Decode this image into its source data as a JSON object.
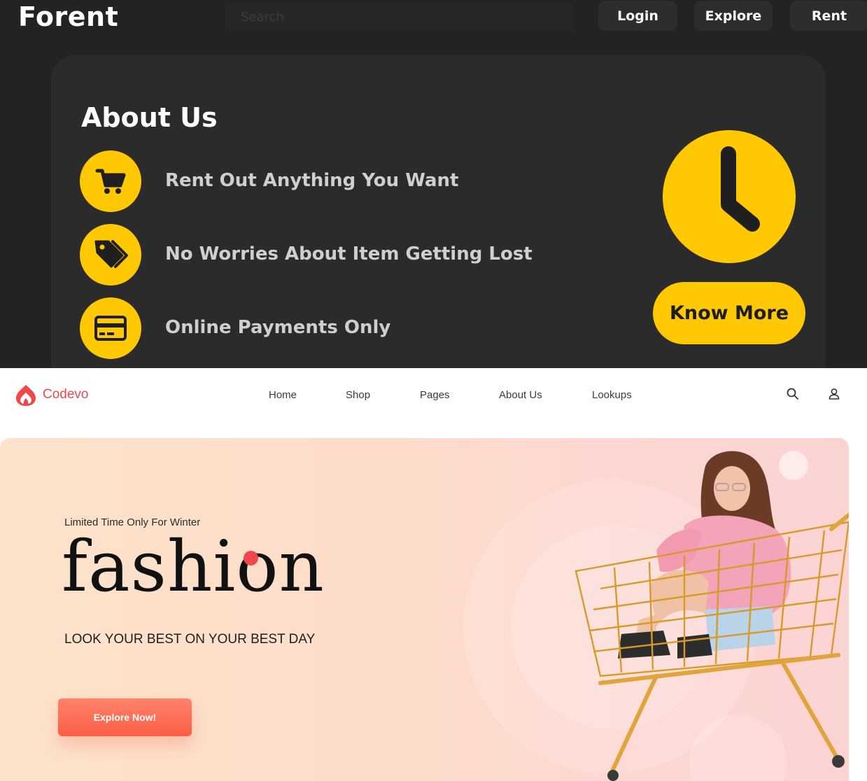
{
  "forent": {
    "logo": "Forent",
    "search": {
      "placeholder": "Search",
      "value": ""
    },
    "nav": {
      "login": "Login",
      "explore": "Explore",
      "rent": "Rent"
    },
    "about": {
      "title": "About Us",
      "features": [
        {
          "icon": "cart-icon",
          "text": "Rent Out Anything You Want"
        },
        {
          "icon": "tag-icon",
          "text": "No Worries About Item Getting Lost"
        },
        {
          "icon": "credit-card-icon",
          "text": "Online Payments Only"
        }
      ],
      "clock_icon": "clock-icon",
      "cta": "Know More"
    },
    "colors": {
      "background": "#232323",
      "card": "#2b2b2b",
      "accent": "#ffc800",
      "feature_text": "#cfcfcf"
    }
  },
  "codevo": {
    "logo": "Codevo",
    "nav": [
      "Home",
      "Shop",
      "Pages",
      "About Us",
      "Lookups"
    ],
    "icons": [
      "search-icon",
      "user-icon"
    ],
    "hero": {
      "kicker": "Limited Time Only For Winter",
      "title": "fashion",
      "subtitle": "LOOK YOUR BEST ON YOUR BEST DAY",
      "cta": "Explore Now!"
    },
    "colors": {
      "brand": "#f0474c",
      "cta": "#fb5e45",
      "hero_bg": "#fde0cf"
    }
  }
}
